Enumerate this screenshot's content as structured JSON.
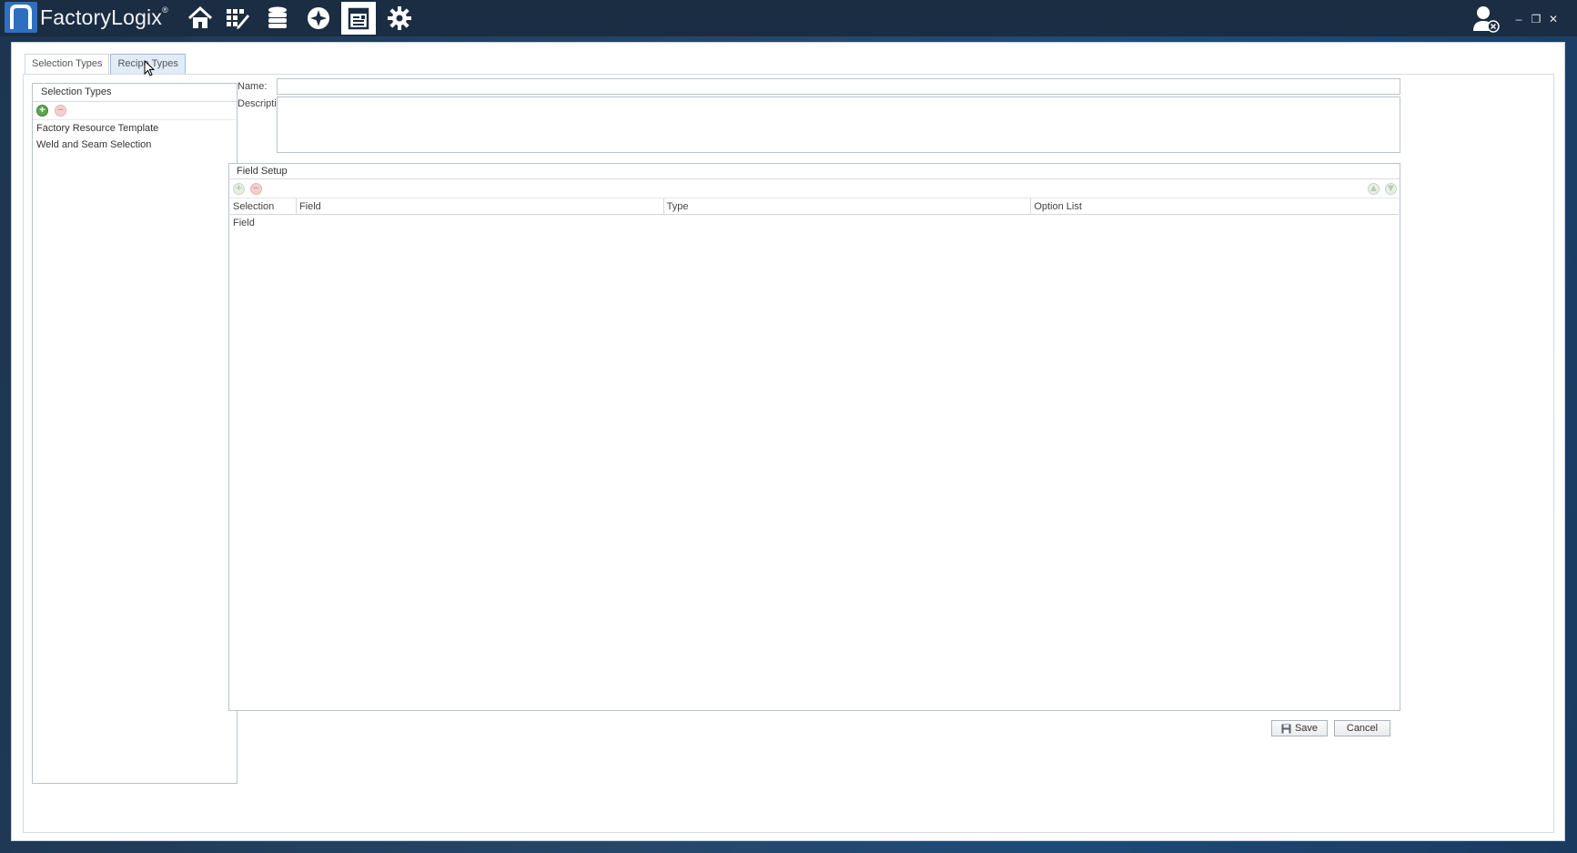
{
  "app": {
    "logo_text": "FactoryLogix",
    "logo_mark": "n",
    "trademark": "®",
    "accent_color": "#2f6fbf",
    "titlebar_color": "#1b2d42"
  },
  "nav": [
    {
      "icon": "home-icon"
    },
    {
      "icon": "grid-edit-icon"
    },
    {
      "icon": "database-icon"
    },
    {
      "icon": "compass-icon"
    },
    {
      "icon": "report-window-icon",
      "active": true
    },
    {
      "icon": "gear-icon"
    }
  ],
  "window_controls": {
    "minimize": "–",
    "restore": "❐",
    "close": "✕"
  },
  "tabs": [
    {
      "label": "Selection Types",
      "selected": true
    },
    {
      "label": "Recipe Types",
      "hover": true
    }
  ],
  "selection_types_panel": {
    "header": "Selection Types",
    "items": [
      "Factory Resource Template",
      "Weld and Seam Selection"
    ]
  },
  "form": {
    "name_label": "Name:",
    "name_value": "",
    "description_label": "Description:",
    "description_value": ""
  },
  "field_setup": {
    "header": "Field Setup",
    "columns": [
      "Selection Field",
      "Field",
      "Type",
      "Option List"
    ],
    "rows": []
  },
  "buttons": {
    "save": "Save",
    "cancel": "Cancel"
  }
}
